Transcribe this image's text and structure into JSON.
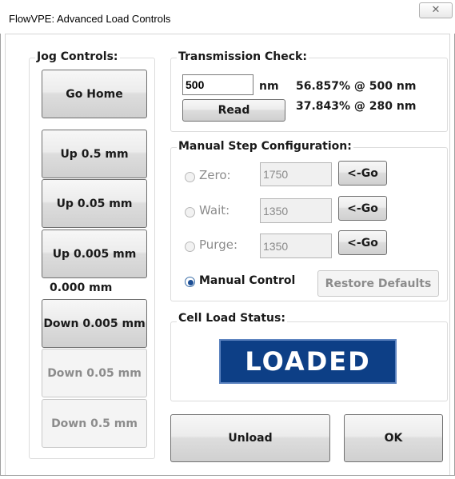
{
  "window": {
    "title": "FlowVPE: Advanced Load Controls",
    "close_glyph": "✕"
  },
  "jog": {
    "label": "Jog Controls:",
    "go_home": "Go Home",
    "up_05": "Up 0.5 mm",
    "up_005": "Up 0.05 mm",
    "up_0005": "Up 0.005 mm",
    "position": "0.000 mm",
    "down_0005": "Down 0.005 mm",
    "down_005": "Down 0.05 mm",
    "down_05": "Down 0.5 mm"
  },
  "transmission": {
    "label": "Transmission Check:",
    "wavelength_value": "500",
    "unit": "nm",
    "read": "Read",
    "result1": "56.857% @ 500 nm",
    "result2": "37.843% @ 280 nm"
  },
  "manual": {
    "label": "Manual Step Configuration:",
    "zero_label": "Zero:",
    "zero_value": "1750",
    "wait_label": "Wait:",
    "wait_value": "1350",
    "purge_label": "Purge:",
    "purge_value": "1350",
    "go": "<-Go",
    "manual_control": "Manual Control",
    "restore": "Restore Defaults"
  },
  "status": {
    "label": "Cell Load Status:",
    "value": "LOADED"
  },
  "actions": {
    "unload": "Unload",
    "ok": "OK"
  }
}
